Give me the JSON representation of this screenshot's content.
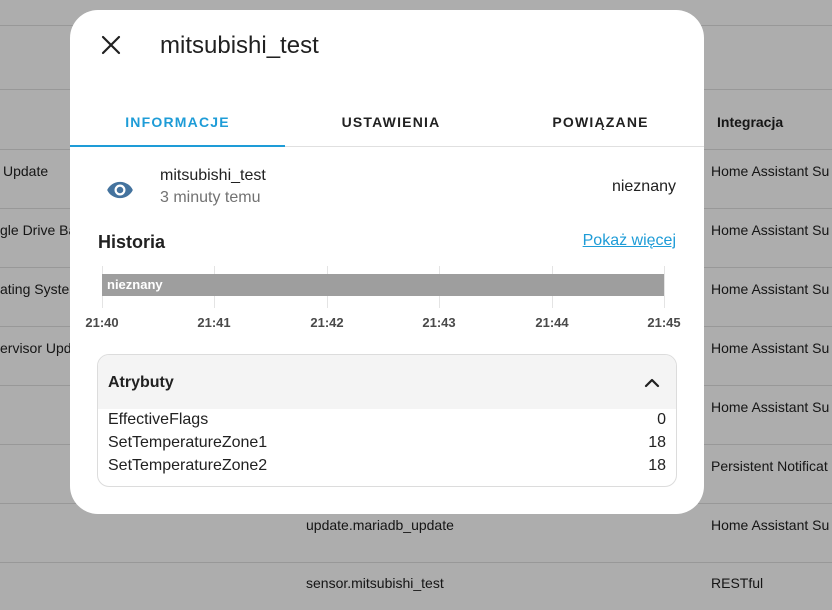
{
  "background": {
    "rows": [
      {
        "col1": "",
        "col2": "",
        "col3": ""
      },
      {
        "col1": "",
        "col2": "",
        "col3": "Integracja"
      },
      {
        "col1": "Update",
        "col2": "",
        "col3": "Home Assistant Su"
      },
      {
        "col1": "gle Drive Ba",
        "col2": "",
        "col3": "Home Assistant Su"
      },
      {
        "col1": "ating Syste",
        "col2": "",
        "col3": "Home Assistant Su"
      },
      {
        "col1": "ervisor Upda",
        "col2": "",
        "col3": "Home Assistant Su"
      },
      {
        "col1": "",
        "col2": "",
        "col3": "Home Assistant Su"
      },
      {
        "col1": "",
        "col2": "",
        "col3": "Persistent Notificat"
      },
      {
        "col1": "",
        "col2": "update.mariadb_update",
        "col3": "Home Assistant Su"
      },
      {
        "col1": "",
        "col2": "sensor.mitsubishi_test",
        "col3": "RESTful"
      }
    ]
  },
  "dialog": {
    "title": "mitsubishi_test",
    "tabs": [
      {
        "label": "INFORMACJE",
        "active": true
      },
      {
        "label": "USTAWIENIA",
        "active": false
      },
      {
        "label": "POWIĄZANE",
        "active": false
      }
    ],
    "entity": {
      "name": "mitsubishi_test",
      "last_changed": "3 minuty temu",
      "state": "nieznany",
      "icon": "eye-icon"
    },
    "history": {
      "title": "Historia",
      "show_more": "Pokaż więcej"
    },
    "attributes": {
      "title": "Atrybuty",
      "items": [
        {
          "key": "EffectiveFlags",
          "value": "0"
        },
        {
          "key": "SetTemperatureZone1",
          "value": "18"
        },
        {
          "key": "SetTemperatureZone2",
          "value": "18"
        }
      ]
    }
  },
  "colors": {
    "accent": "#1e9cd7",
    "icon": "#44739e",
    "timeline_bar": "#9e9e9e"
  },
  "chart_data": {
    "type": "timeline",
    "series": [
      {
        "state": "nieznany",
        "start": "21:40",
        "end": "21:45"
      }
    ],
    "x_ticks": [
      "21:40",
      "21:41",
      "21:42",
      "21:43",
      "21:44",
      "21:45"
    ]
  }
}
